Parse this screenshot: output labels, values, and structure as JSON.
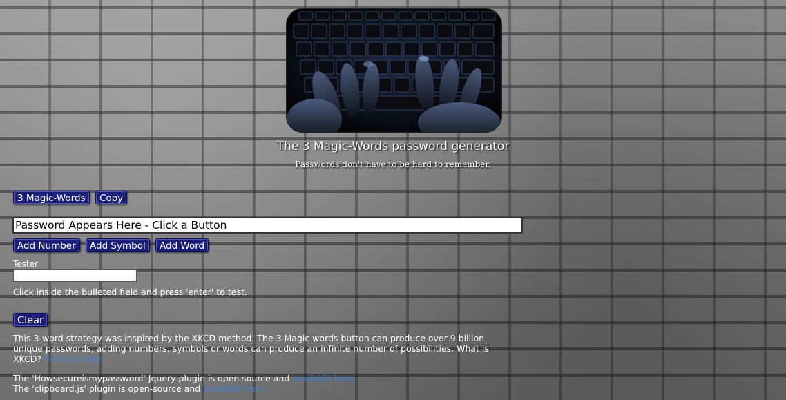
{
  "header": {
    "title": "The 3 Magic-Words password generator",
    "subtitle": "Passwords don't have to be hard to remember.",
    "image_alt": "keyboard-hands-image"
  },
  "buttons": {
    "magic_words": "3 Magic-Words",
    "copy": "Copy",
    "add_number": "Add Number",
    "add_symbol": "Add Symbol",
    "add_word": "Add Word",
    "clear": "Clear"
  },
  "output": {
    "value": "Password Appears Here - Click a Button"
  },
  "tester": {
    "label": "Tester",
    "value": "",
    "hint": "Click inside the bulleted field and press 'enter' to test."
  },
  "info": {
    "p1_text": "This 3-word strategy was inspired by the XKCD method. The 3 Magic words button can produce over 9 billion unique passwords, adding numbers, symbols or words can produce an infinite number of possibilities. What is XKCD? ",
    "p1_link": "Find out here.",
    "p2_line1_text": "The 'Howsecureismypassword' Jquery plugin is open source and ",
    "p2_line1_link": "available here.",
    "p2_line2_text": "The 'clipboard.js' plugin is open-source and ",
    "p2_line2_link": "available here."
  },
  "colors": {
    "button_bg": "#1b1f7a",
    "link": "#3e82d6",
    "background": "#8d8d8d"
  }
}
